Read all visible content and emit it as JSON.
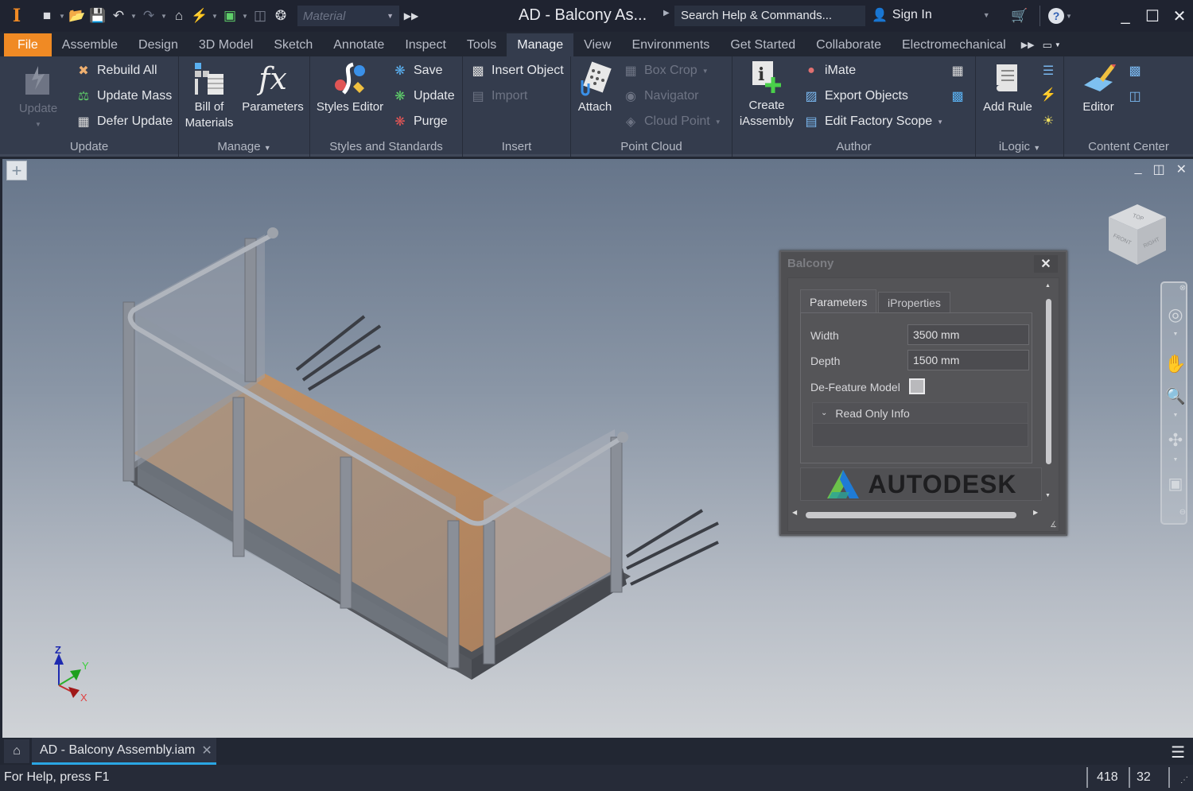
{
  "titlebar": {
    "app_icon": "inventor-I-icon",
    "material_placeholder": "Material",
    "title": "AD - Balcony As...",
    "search_placeholder": "Search Help & Commands...",
    "sign_in": "Sign In",
    "quick_access": [
      "new-icon",
      "open-icon",
      "save-icon",
      "undo-icon",
      "redo-icon",
      "home-icon",
      "update-icon",
      "select-icon",
      "measure-icon",
      "appearance-icon"
    ]
  },
  "ribbon_tabs": [
    "File",
    "Assemble",
    "Design",
    "3D Model",
    "Sketch",
    "Annotate",
    "Inspect",
    "Tools",
    "Manage",
    "View",
    "Environments",
    "Get Started",
    "Collaborate",
    "Electromechanical"
  ],
  "active_tab": "Manage",
  "ribbon": {
    "update": {
      "label": "Update",
      "big": "Update",
      "items": [
        "Rebuild All",
        "Update Mass",
        "Defer Update"
      ]
    },
    "manage": {
      "label": "Manage",
      "bom_line1": "Bill of",
      "bom_line2": "Materials",
      "parameters": "Parameters"
    },
    "styles": {
      "label": "Styles and Standards",
      "editor": "Styles Editor",
      "items": [
        "Save",
        "Update",
        "Purge"
      ]
    },
    "insert": {
      "label": "Insert",
      "items": [
        "Insert Object",
        "Import"
      ]
    },
    "pointcloud": {
      "label": "Point Cloud",
      "attach": "Attach",
      "items": [
        "Box Crop",
        "Navigator",
        "Cloud Point"
      ]
    },
    "author": {
      "label": "Author",
      "create_line1": "Create",
      "create_line2": "iAssembly",
      "items": [
        "iMate",
        "Export Objects",
        "Edit Factory Scope"
      ]
    },
    "ilogic": {
      "label": "iLogic",
      "add_rule": "Add Rule"
    },
    "content": {
      "label": "Content Center",
      "editor": "Editor"
    }
  },
  "dialog": {
    "title": "Balcony",
    "tabs": [
      "Parameters",
      "iProperties"
    ],
    "fields": [
      {
        "label": "Width",
        "value": "3500 mm"
      },
      {
        "label": "Depth",
        "value": "1500 mm"
      }
    ],
    "checkbox_label": "De-Feature Model",
    "checkbox_checked": false,
    "group": "Read Only Info",
    "logo": "AUTODESK"
  },
  "viewcube": {
    "top": "TOP",
    "front": "FRONT",
    "right": "RIGHT"
  },
  "triad": {
    "x": "X",
    "y": "Y",
    "z": "Z"
  },
  "document_tab": "AD - Balcony Assembly.iam",
  "status": {
    "help": "For Help, press F1",
    "count1": "418",
    "count2": "32"
  }
}
